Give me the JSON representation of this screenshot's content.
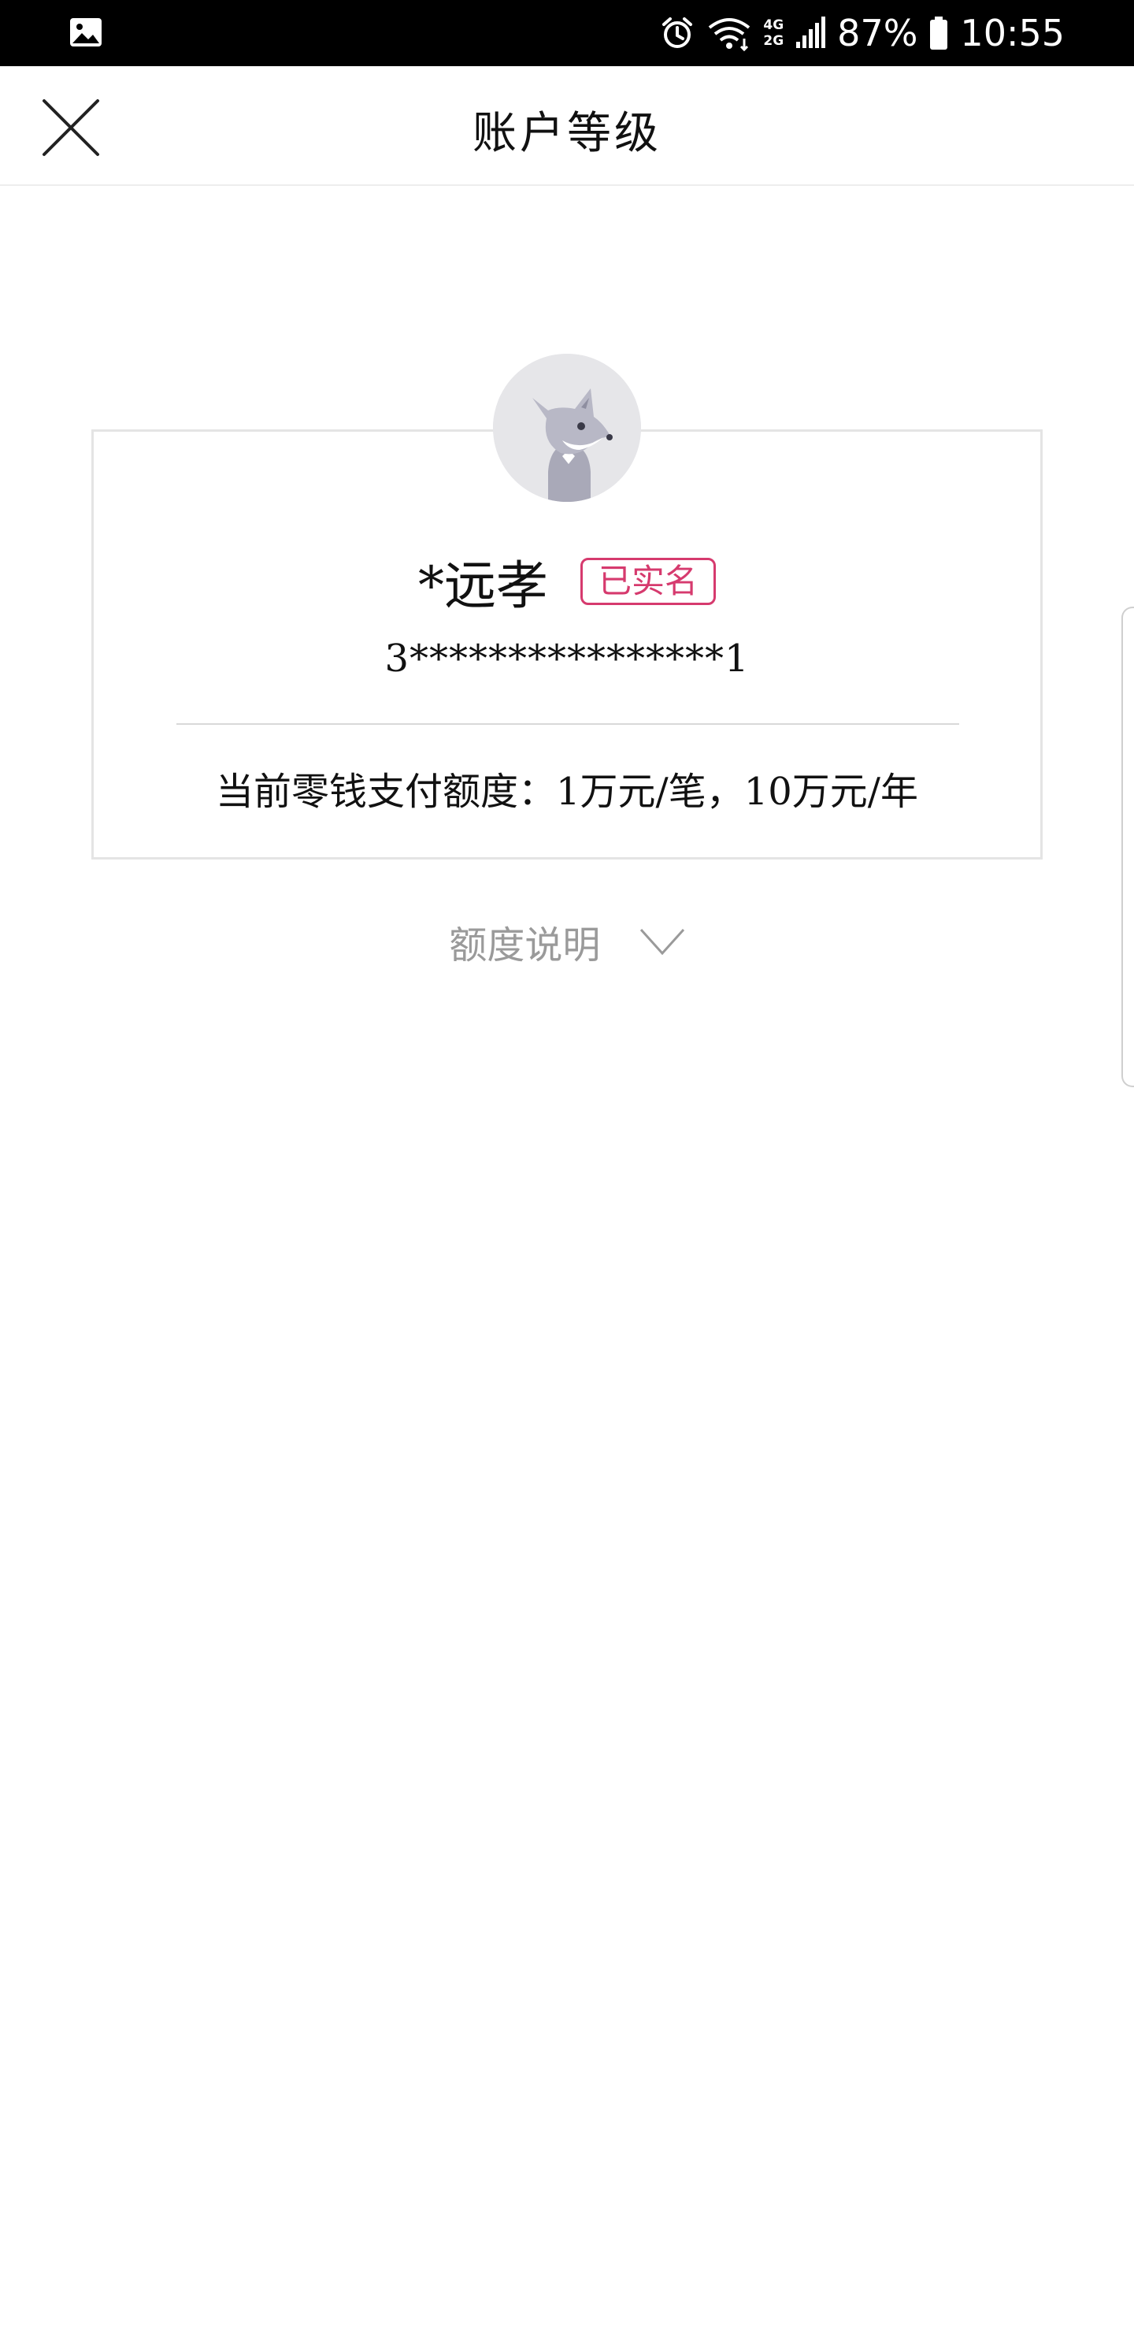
{
  "status_bar": {
    "left_icon": "gallery-icon",
    "right_icons": [
      "alarm-icon",
      "wifi-icon",
      "signal-icon"
    ],
    "network_top": "4G",
    "network_bottom": "2G",
    "battery": "87%",
    "time": "10:55"
  },
  "header": {
    "close_icon": "close-icon",
    "title": "账户等级"
  },
  "profile": {
    "avatar": "fox-avatar-icon",
    "name": "*远孝",
    "verified_label": "已实名",
    "id_number": "3****************1",
    "limit_text": "当前零钱支付额度：1万元/笔，10万元/年"
  },
  "explain": {
    "label": "额度说明",
    "icon": "chevron-down-icon"
  },
  "colors": {
    "status_bar_bg": "#000000",
    "accent_badge": "#d63a6e",
    "muted_text": "#9a9a9a",
    "card_border": "#e4e4e4"
  }
}
